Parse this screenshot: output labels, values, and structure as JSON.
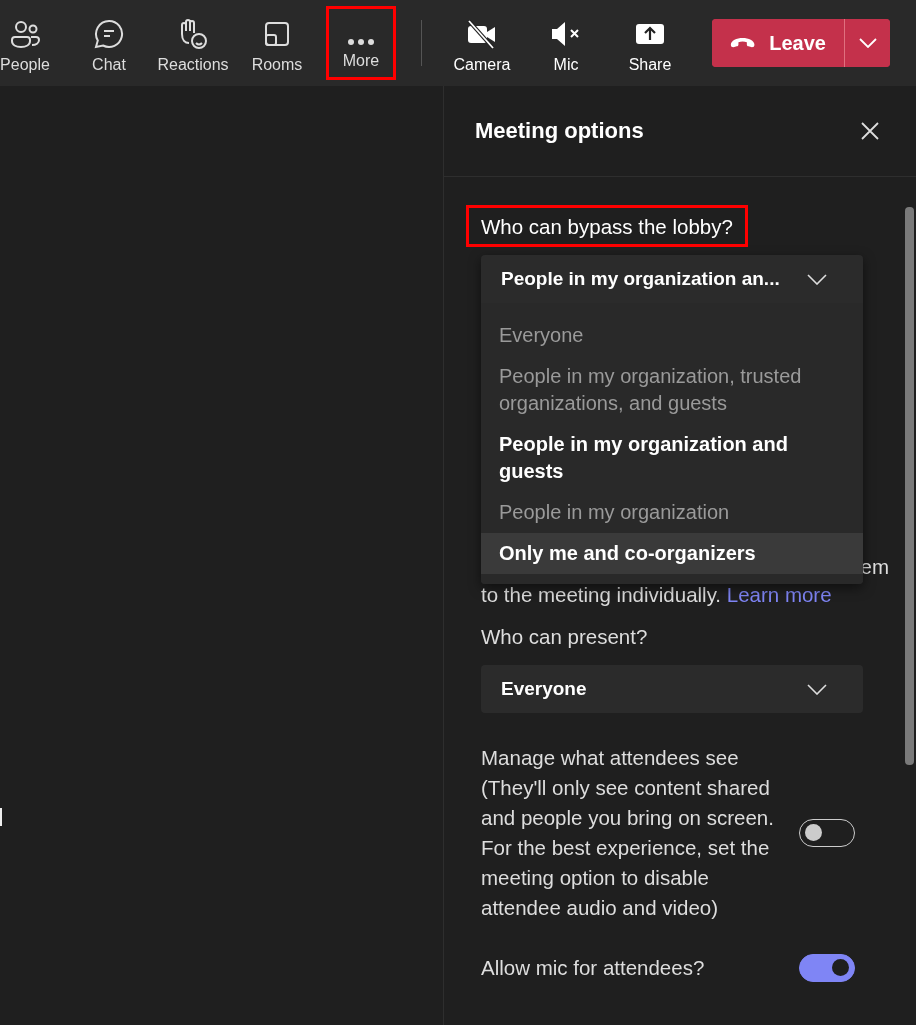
{
  "toolbar": {
    "items": [
      {
        "kind": "people",
        "label": "People",
        "highlighted": false
      },
      {
        "kind": "chat",
        "label": "Chat",
        "highlighted": false
      },
      {
        "kind": "reactions",
        "label": "Reactions",
        "highlighted": false
      },
      {
        "kind": "rooms",
        "label": "Rooms",
        "highlighted": false
      },
      {
        "kind": "more",
        "label": "More",
        "highlighted": true
      },
      {
        "kind": "camera",
        "label": "Camera",
        "highlighted": false
      },
      {
        "kind": "mic",
        "label": "Mic",
        "highlighted": false
      },
      {
        "kind": "share",
        "label": "Share",
        "highlighted": false
      }
    ],
    "leave_button": {
      "label": "Leave"
    }
  },
  "panel": {
    "title": "Meeting options",
    "lobby": {
      "label": "Who can bypass the lobby?",
      "highlighted": true,
      "value": "People in my organization an...",
      "expanded": true,
      "options": [
        {
          "label": "Everyone",
          "selected": false,
          "hovered": false
        },
        {
          "label": "People in my organization, trusted organizations, and guests",
          "selected": false,
          "hovered": false
        },
        {
          "label": "People in my organization and guests",
          "selected": true,
          "hovered": false
        },
        {
          "label": "People in my organization",
          "selected": false,
          "hovered": false
        },
        {
          "label": "Only me and co-organizers",
          "selected": false,
          "hovered": true
        }
      ]
    },
    "covered_text": {
      "fragment": "em",
      "line": "to the meeting individually.",
      "link": "Learn more"
    },
    "present": {
      "label": "Who can present?",
      "value": "Everyone"
    },
    "toggles": [
      {
        "label": "Manage what attendees see (They'll only see content shared and people you bring on screen. For the best experience, set the meeting option to disable attendee audio and video)",
        "on": false
      },
      {
        "label": "Allow mic for attendees?",
        "on": true
      }
    ]
  }
}
